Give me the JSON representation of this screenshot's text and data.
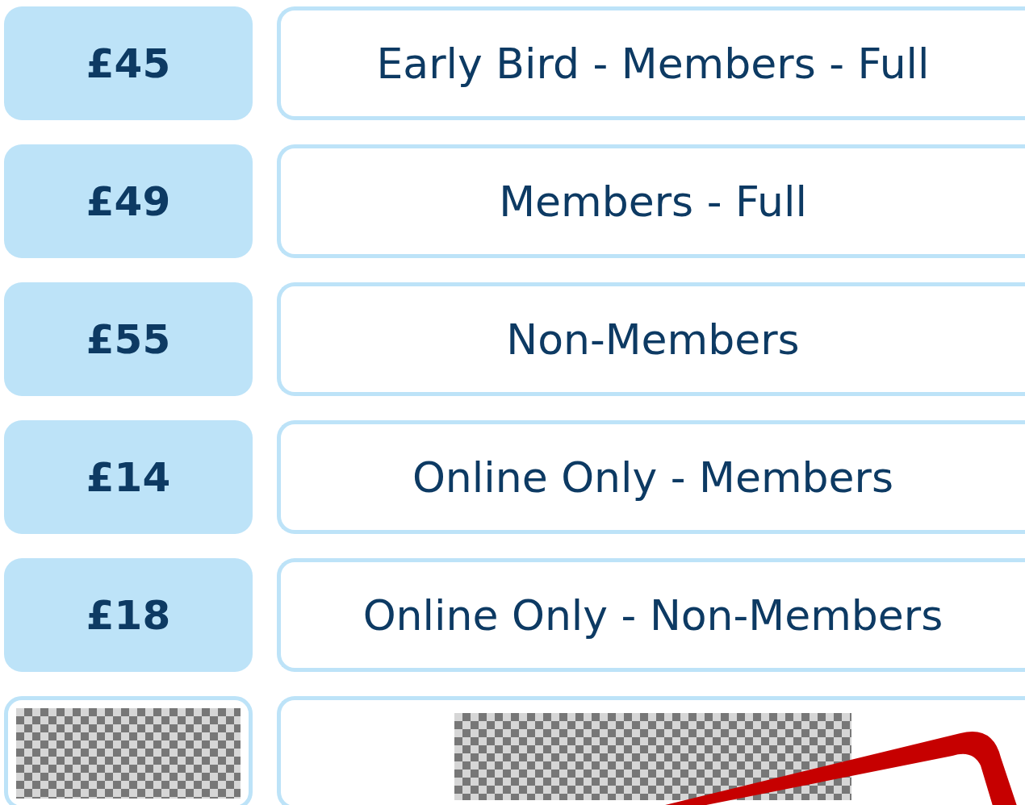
{
  "prices": [
    {
      "kind": "text",
      "price": "£45",
      "label": "Early Bird - Members - Full"
    },
    {
      "kind": "text",
      "price": "£49",
      "label": "Members - Full"
    },
    {
      "kind": "text",
      "price": "£55",
      "label": "Non-Members"
    },
    {
      "kind": "text",
      "price": "£14",
      "label": "Online Only - Members"
    },
    {
      "kind": "text",
      "price": "£18",
      "label": "Online Only - Non-Members"
    },
    {
      "kind": "redacted",
      "stamp": true
    }
  ]
}
